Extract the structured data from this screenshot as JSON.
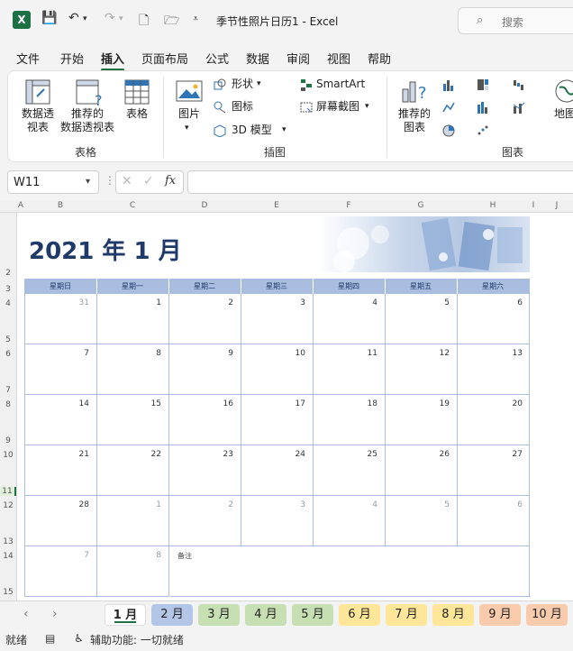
{
  "titlebar": {
    "title": "季节性照片日历1  -  Excel",
    "search_placeholder": "搜索"
  },
  "tabs": [
    "文件",
    "开始",
    "插入",
    "页面布局",
    "公式",
    "数据",
    "审阅",
    "视图",
    "帮助"
  ],
  "ribbon": {
    "pivot_table": "数据透\n视表",
    "recommended_pivot": "推荐的\n数据透视表",
    "table": "表格",
    "group_tables": "表格",
    "pictures": "图片",
    "shapes": "形状",
    "icons": "图标",
    "models_3d": "3D 模型",
    "smartart": "SmartArt",
    "screenshot": "屏幕截图",
    "group_illustrations": "插图",
    "recommended_charts": "推荐的\n图表",
    "maps": "地图",
    "group_charts": "图表"
  },
  "formula_bar": {
    "name_box": "W11",
    "formula": ""
  },
  "columns": [
    "A",
    "B",
    "C",
    "D",
    "E",
    "F",
    "G",
    "H",
    "I",
    "J"
  ],
  "rows": [
    "2",
    "3",
    "4",
    "5",
    "6",
    "7",
    "8",
    "9",
    "10",
    "11",
    "12",
    "13",
    "14",
    "15"
  ],
  "calendar": {
    "title": "2021 年 1 月",
    "weekdays": [
      "星期日",
      "星期一",
      "星期二",
      "星期三",
      "星期四",
      "星期五",
      "星期六"
    ],
    "weeks": [
      [
        "31",
        "1",
        "2",
        "3",
        "4",
        "5",
        "6"
      ],
      [
        "7",
        "8",
        "9",
        "10",
        "11",
        "12",
        "13"
      ],
      [
        "14",
        "15",
        "16",
        "17",
        "18",
        "19",
        "20"
      ],
      [
        "21",
        "22",
        "23",
        "24",
        "25",
        "26",
        "27"
      ],
      [
        "28",
        "1",
        "2",
        "3",
        "4",
        "5",
        "6"
      ],
      [
        "7",
        "8"
      ]
    ],
    "notes_label": "备注"
  },
  "sheet_tabs": [
    {
      "label": "1 月",
      "color": "#ffffff",
      "active": true
    },
    {
      "label": "2 月",
      "color": "#b4c6e7"
    },
    {
      "label": "3 月",
      "color": "#c6e0b4"
    },
    {
      "label": "4 月",
      "color": "#c6e0b4"
    },
    {
      "label": "5 月",
      "color": "#c6e0b4"
    },
    {
      "label": "6 月",
      "color": "#ffe699"
    },
    {
      "label": "7 月",
      "color": "#ffe699"
    },
    {
      "label": "8 月",
      "color": "#ffe699"
    },
    {
      "label": "9 月",
      "color": "#f8cbad"
    },
    {
      "label": "10 月",
      "color": "#f8cbad"
    }
  ],
  "status": {
    "ready": "就绪",
    "accessibility": "辅助功能: 一切就绪"
  },
  "colors": {
    "accent_green": "#1e7145",
    "calendar_header": "#a9bde0",
    "title_blue": "#1f3a68"
  }
}
